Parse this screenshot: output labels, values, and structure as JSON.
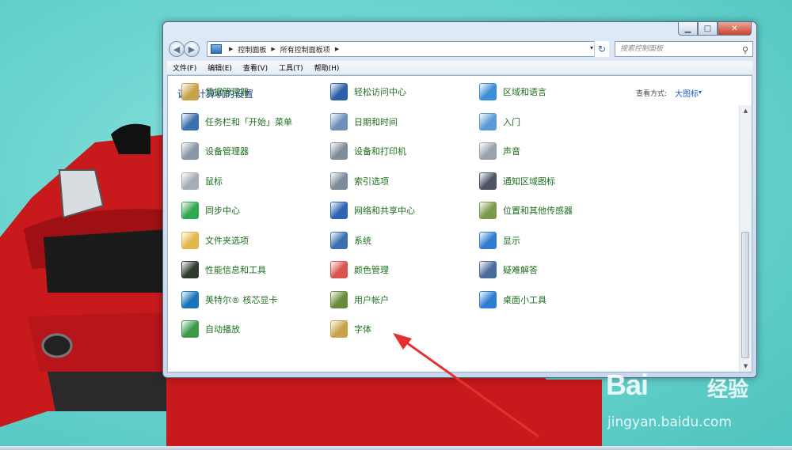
{
  "window": {
    "caption_buttons": {
      "minimize": "▁",
      "maximize": "□",
      "close": "✕"
    },
    "nav": {
      "back": "◀",
      "forward": "▶"
    },
    "address": {
      "crumbs": [
        "控制面板",
        "所有控制面板项"
      ],
      "separator": "▶",
      "dropdown": "▾"
    },
    "refresh_label": "↻",
    "search": {
      "placeholder": "搜索控制面板",
      "icon": "search-icon"
    },
    "menu": [
      "文件(F)",
      "编辑(E)",
      "查看(V)",
      "工具(T)",
      "帮助(H)"
    ],
    "title": "调整计算机的设置",
    "view_label": "查看方式:",
    "view_value": "大图标",
    "view_caret": "▾",
    "scroll": {
      "up": "▲",
      "down": "▼"
    }
  },
  "items": [
    {
      "label": "凭据管理器",
      "icon": "credential-vault-icon",
      "color": "#c9a34a"
    },
    {
      "label": "轻松访问中心",
      "icon": "ease-of-access-icon",
      "color": "#2a5fa8"
    },
    {
      "label": "区域和语言",
      "icon": "globe-icon",
      "color": "#3b8ed8"
    },
    {
      "label": "任务栏和「开始」菜单",
      "icon": "taskbar-icon",
      "color": "#3c6fae"
    },
    {
      "label": "日期和时间",
      "icon": "calendar-clock-icon",
      "color": "#6e8fb8"
    },
    {
      "label": "入门",
      "icon": "getting-started-icon",
      "color": "#5b9bd5"
    },
    {
      "label": "设备管理器",
      "icon": "device-manager-icon",
      "color": "#8a97a6"
    },
    {
      "label": "设备和打印机",
      "icon": "printer-icon",
      "color": "#7f8c99"
    },
    {
      "label": "声音",
      "icon": "speaker-icon",
      "color": "#9aa3ad"
    },
    {
      "label": "鼠标",
      "icon": "mouse-icon",
      "color": "#a7adb5"
    },
    {
      "label": "索引选项",
      "icon": "magnifier-icon",
      "color": "#7c8a99"
    },
    {
      "label": "通知区域图标",
      "icon": "notification-area-icon",
      "color": "#4b5563"
    },
    {
      "label": "同步中心",
      "icon": "sync-icon",
      "color": "#2fa84f"
    },
    {
      "label": "网络和共享中心",
      "icon": "network-icon",
      "color": "#2d64b3"
    },
    {
      "label": "位置和其他传感器",
      "icon": "sensor-icon",
      "color": "#7a9a4a"
    },
    {
      "label": "文件夹选项",
      "icon": "folder-options-icon",
      "color": "#e3b84a"
    },
    {
      "label": "系统",
      "icon": "system-icon",
      "color": "#3a6fb0"
    },
    {
      "label": "显示",
      "icon": "display-icon",
      "color": "#2f7dd1"
    },
    {
      "label": "性能信息和工具",
      "icon": "performance-icon",
      "color": "#2e3b2e"
    },
    {
      "label": "颜色管理",
      "icon": "color-management-icon",
      "color": "#d9534f"
    },
    {
      "label": "疑难解答",
      "icon": "troubleshooting-icon",
      "color": "#4a6a9a"
    },
    {
      "label": "英特尔® 核芯显卡",
      "icon": "intel-graphics-icon",
      "color": "#1a73b8"
    },
    {
      "label": "用户帐户",
      "icon": "user-accounts-icon",
      "color": "#6a8c3a"
    },
    {
      "label": "桌面小工具",
      "icon": "desktop-gadgets-icon",
      "color": "#2f7dd1"
    },
    {
      "label": "自动播放",
      "icon": "autoplay-icon",
      "color": "#3c9a4a"
    },
    {
      "label": "字体",
      "icon": "fonts-icon",
      "color": "#c9a34a"
    }
  ],
  "watermark": {
    "brand": "Bai",
    "suffix": "经验",
    "url": "jingyan.baidu.com"
  }
}
